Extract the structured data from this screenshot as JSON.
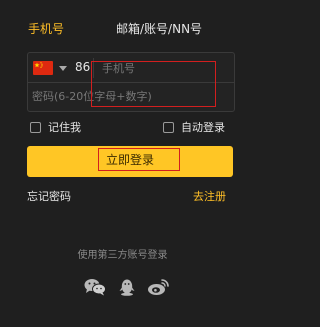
{
  "tabs": {
    "phone": "手机号",
    "email_account": "邮箱/账号/NN号",
    "active": "phone"
  },
  "form": {
    "country_code": "86",
    "phone_placeholder": "手机号",
    "password_placeholder": "密码(6-20位字母+数字)"
  },
  "options": {
    "remember_label": "记住我",
    "auto_login_label": "自动登录"
  },
  "login_button": "立即登录",
  "links": {
    "forgot_password": "忘记密码",
    "register": "去注册"
  },
  "third_party": {
    "label": "使用第三方账号登录",
    "icons": [
      "wechat-icon",
      "qq-icon",
      "weibo-icon"
    ]
  },
  "colors": {
    "accent": "#ffc625",
    "background": "#1f1f1f",
    "highlight": "#d21f1f"
  }
}
